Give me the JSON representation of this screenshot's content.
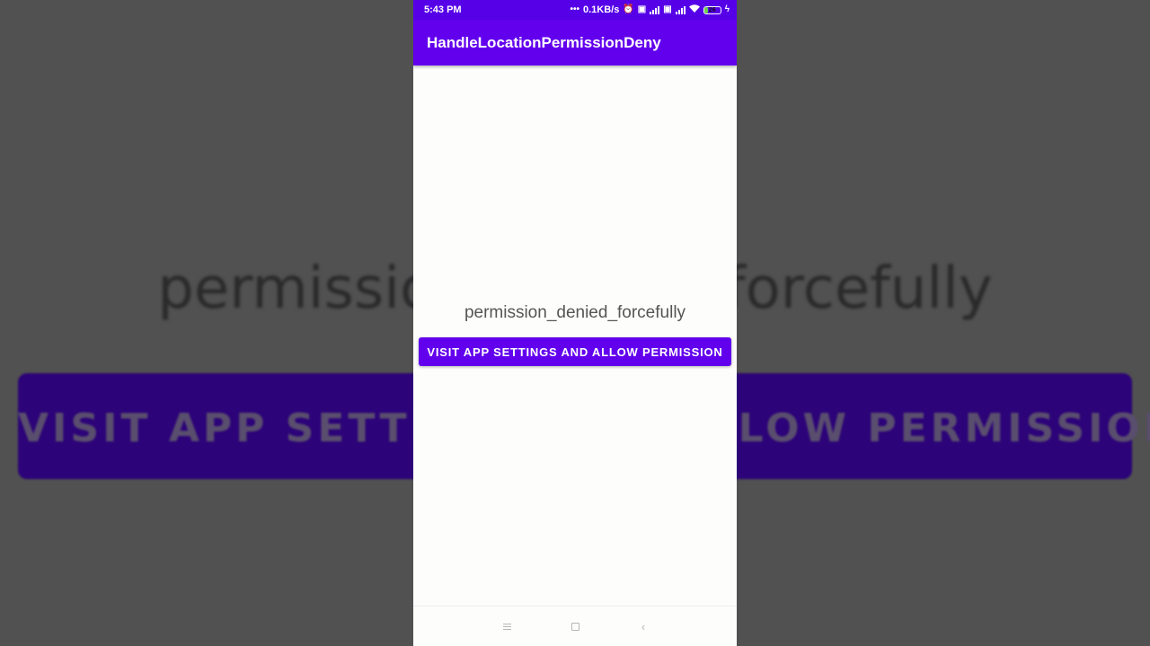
{
  "background": {
    "text": "permission_denied_forcefully",
    "button_text": "VISIT APP SETTINGS AND ALLOW PERMISSION"
  },
  "status_bar": {
    "time": "5:43 PM",
    "network_speed": "0.1KB/s",
    "battery_level": "26",
    "icons": [
      "more-dots-icon",
      "alarm-icon",
      "volte-icon",
      "signal-icon",
      "volte-icon",
      "signal-icon",
      "wifi-icon",
      "battery-icon",
      "charging-icon"
    ]
  },
  "app_bar": {
    "title": "HandleLocationPermissionDeny"
  },
  "main": {
    "message": "permission_denied_forcefully",
    "button_label": "VISIT APP SETTINGS AND ALLOW PERMISSION"
  },
  "nav_bar": {
    "buttons": [
      "menu-icon",
      "home-icon",
      "back-icon"
    ]
  },
  "colors": {
    "primary": "#6200ee",
    "primary_dark": "#5600e8",
    "text": "#555555",
    "surface": "#fdfefc"
  }
}
